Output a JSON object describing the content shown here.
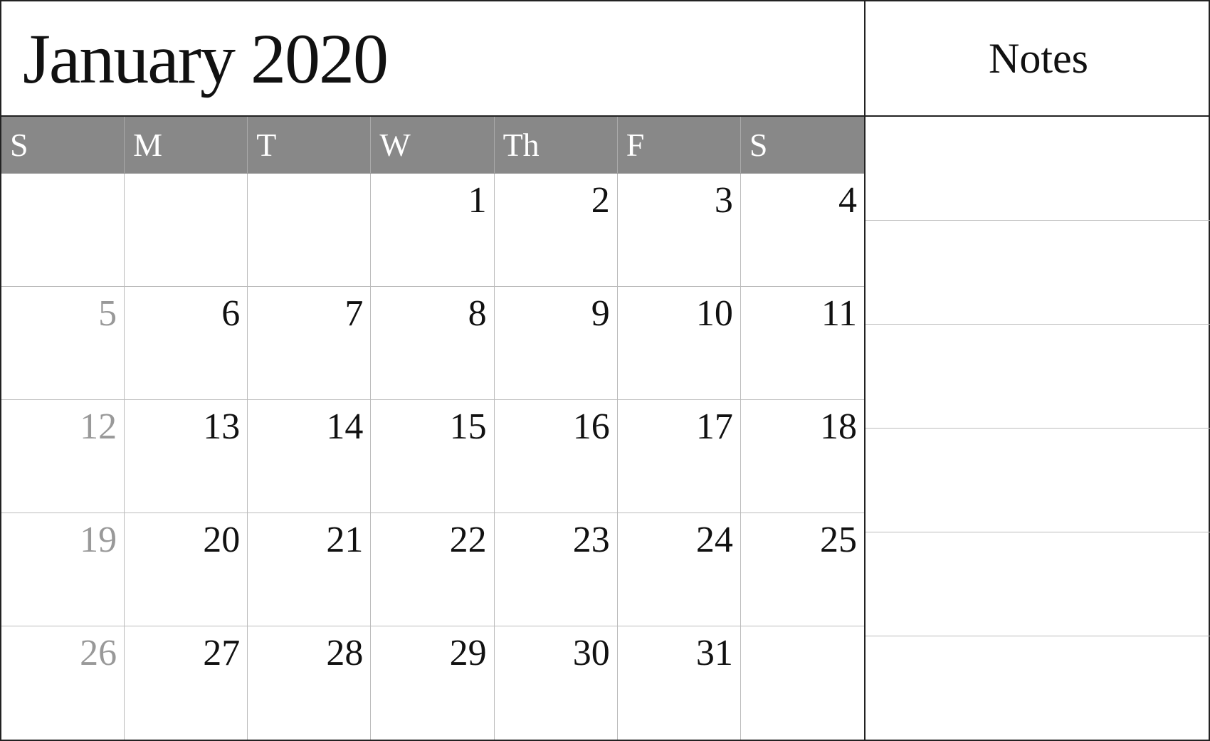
{
  "header": {
    "title": "January 2020"
  },
  "notes": {
    "title": "Notes"
  },
  "days": {
    "headers": [
      "S",
      "M",
      "T",
      "W",
      "Th",
      "F",
      "S"
    ]
  },
  "weeks": [
    [
      {
        "day": "",
        "empty": true
      },
      {
        "day": "",
        "empty": true
      },
      {
        "day": "",
        "empty": true
      },
      {
        "day": "1",
        "empty": false
      },
      {
        "day": "2",
        "empty": false
      },
      {
        "day": "3",
        "empty": false
      },
      {
        "day": "4",
        "empty": false
      }
    ],
    [
      {
        "day": "5",
        "empty": false,
        "sunday": true
      },
      {
        "day": "6",
        "empty": false
      },
      {
        "day": "7",
        "empty": false
      },
      {
        "day": "8",
        "empty": false
      },
      {
        "day": "9",
        "empty": false
      },
      {
        "day": "10",
        "empty": false
      },
      {
        "day": "11",
        "empty": false
      }
    ],
    [
      {
        "day": "12",
        "empty": false,
        "sunday": true
      },
      {
        "day": "13",
        "empty": false
      },
      {
        "day": "14",
        "empty": false
      },
      {
        "day": "15",
        "empty": false
      },
      {
        "day": "16",
        "empty": false
      },
      {
        "day": "17",
        "empty": false
      },
      {
        "day": "18",
        "empty": false
      }
    ],
    [
      {
        "day": "19",
        "empty": false,
        "sunday": true
      },
      {
        "day": "20",
        "empty": false
      },
      {
        "day": "21",
        "empty": false
      },
      {
        "day": "22",
        "empty": false
      },
      {
        "day": "23",
        "empty": false
      },
      {
        "day": "24",
        "empty": false
      },
      {
        "day": "25",
        "empty": false
      }
    ],
    [
      {
        "day": "26",
        "empty": false,
        "sunday": true
      },
      {
        "day": "27",
        "empty": false
      },
      {
        "day": "28",
        "empty": false
      },
      {
        "day": "29",
        "empty": false
      },
      {
        "day": "30",
        "empty": false
      },
      {
        "day": "31",
        "empty": false
      },
      {
        "day": "",
        "empty": true
      }
    ]
  ]
}
